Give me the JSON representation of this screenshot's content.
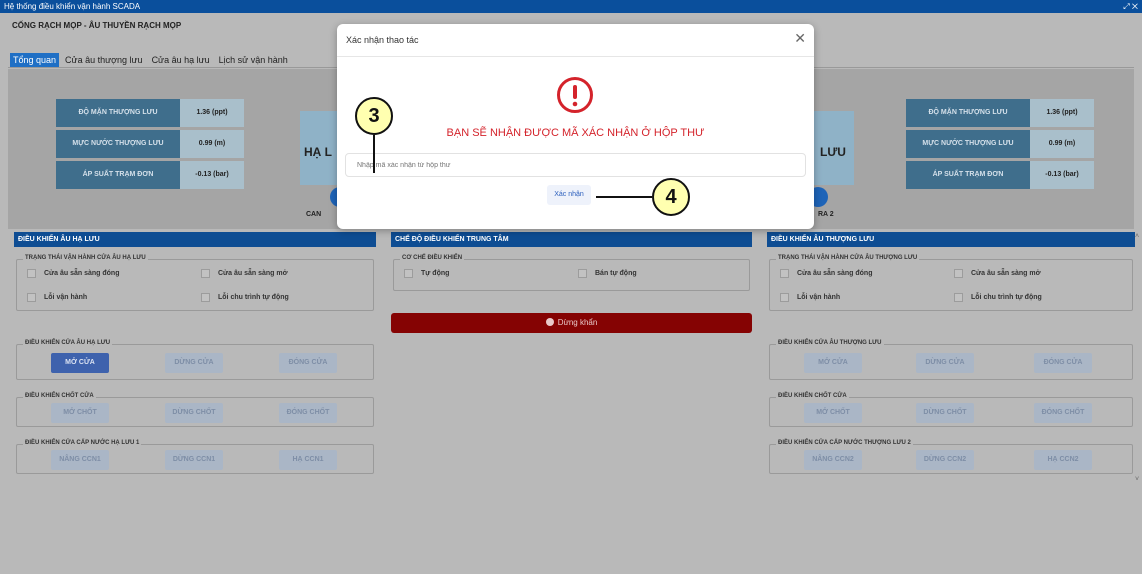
{
  "window": {
    "title": "Hệ thống điều khiển vận hành SCADA",
    "controls": "⤢ ✕"
  },
  "station": {
    "title": "CỐNG RẠCH MỌP - ÂU THUYỀN RẠCH MỌP"
  },
  "tabs": [
    {
      "label": "Tổng quan",
      "active": true
    },
    {
      "label": "Cửa âu thượng lưu"
    },
    {
      "label": "Cửa âu hạ lưu"
    },
    {
      "label": "Lịch sử vận hành"
    }
  ],
  "overview": {
    "left": [
      {
        "label": "ĐỘ MẶN THƯỢNG LƯU",
        "value": "1.36 (ppt)"
      },
      {
        "label": "MỰC NƯỚC THƯỢNG LƯU",
        "value": "0.99 (m)"
      },
      {
        "label": "ÁP SUẤT TRẠM ĐƠN",
        "value": "-0.13 (bar)"
      }
    ],
    "right": [
      {
        "label": "ĐỘ MẶN THƯỢNG LƯU",
        "value": "1.36 (ppt)"
      },
      {
        "label": "MỰC NƯỚC THƯỢNG LƯU",
        "value": "0.99 (m)"
      },
      {
        "label": "ÁP SUẤT TRẠM ĐƠN",
        "value": "-0.13 (bar)"
      }
    ],
    "gate_left_label": "HẠ L",
    "gate_left_sub": "CAN",
    "gate_right_label": "LƯU",
    "gate_right_sub": "RA 2"
  },
  "left_panel": {
    "title": "ĐIỀU KHIỂN ÂU HẠ LƯU",
    "status_title": "TRẠNG THÁI VẬN HÀNH CỬA ÂU HẠ LƯU",
    "status": [
      "Cửa âu sẵn sàng đóng",
      "Cửa âu sẵn sàng mở",
      "Lỗi vận hành",
      "Lỗi chu trình tự động"
    ],
    "gate_title": "ĐIỀU KHIỂN CỬA ÂU HẠ LƯU",
    "gate_btns": [
      "MỞ CỬA",
      "DỪNG CỬA",
      "ĐÓNG CỬA"
    ],
    "latch_title": "ĐIỀU KHIỂN CHỐT CỬA",
    "latch_btns": [
      "MỞ CHỐT",
      "DỪNG CHỐT",
      "ĐÓNG CHỐT"
    ],
    "feed_title": "ĐIỀU KHIỂN CỬA CẤP NƯỚC HẠ LƯU 1",
    "feed_btns": [
      "NÂNG CCN1",
      "DỪNG CCN1",
      "HẠ CCN1"
    ]
  },
  "center_panel": {
    "title": "CHẾ ĐỘ ĐIỀU KHIỂN TRUNG TÂM",
    "mode_title": "CƠ CHẾ ĐIỀU KHIỂN",
    "modes": [
      "Tự động",
      "Bán tự động"
    ],
    "estop": "Dừng khẩn"
  },
  "right_panel": {
    "title": "ĐIỀU KHIỂN ÂU THƯỢNG LƯU",
    "status_title": "TRẠNG THÁI VẬN HÀNH CỬA ÂU THƯỢNG LƯU",
    "status": [
      "Cửa âu sẵn sàng đóng",
      "Cửa âu sẵn sàng mở",
      "Lỗi vận hành",
      "Lỗi chu trình tự động"
    ],
    "gate_title": "ĐIỀU KHIỂN CỬA ÂU THƯỢNG LƯU",
    "gate_btns": [
      "MỞ CỬA",
      "DỪNG CỬA",
      "ĐÓNG CỬA"
    ],
    "latch_title": "ĐIỀU KHIỂN CHỐT CỬA",
    "latch_btns": [
      "MỞ CHỐT",
      "DỪNG CHỐT",
      "ĐÓNG CHỐT"
    ],
    "feed_title": "ĐIỀU KHIỂN CỬA CẤP NƯỚC THƯỢNG LƯU 2",
    "feed_btns": [
      "NÂNG CCN2",
      "DỪNG CCN2",
      "HẠ CCN2"
    ]
  },
  "modal": {
    "title": "Xác nhận thao tác",
    "close": "✕",
    "icon": "warning-icon",
    "message": "BẠN SẼ NHẬN ĐƯỢC MÃ XÁC NHẬN Ở HỘP THƯ",
    "input_placeholder": "Nhập mã xác nhận từ hộp thư",
    "confirm": "Xác nhận"
  },
  "callouts": [
    "3",
    "4"
  ],
  "colors": {
    "header": "#0a4f9c",
    "panel_header": "#0e4d93",
    "estop": "#850303",
    "warning": "#d4232b",
    "primary": "#3e62ad"
  }
}
